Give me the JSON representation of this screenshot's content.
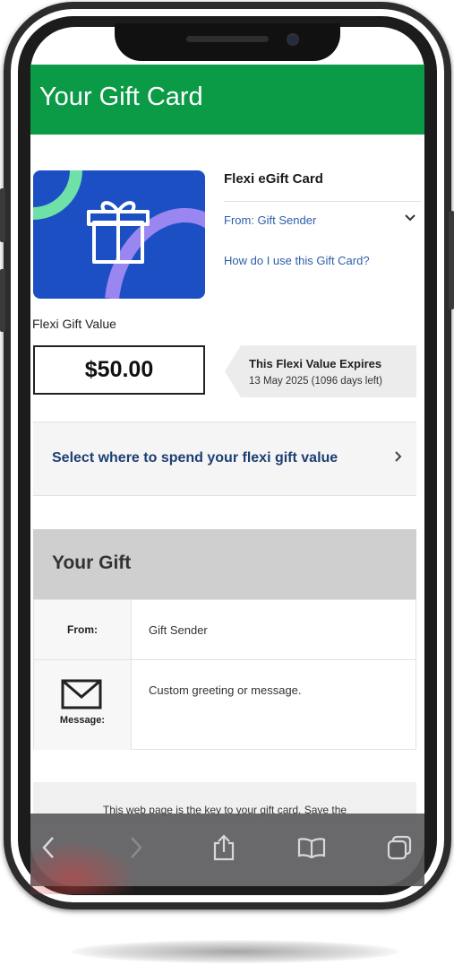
{
  "header": {
    "title": "Your Gift Card"
  },
  "card": {
    "title": "Flexi eGift Card",
    "from_selector": "From: Gift Sender",
    "help_link": "How do I use this Gift Card?",
    "image_icon": "gift-icon",
    "card_color": "#1d4fc4"
  },
  "value": {
    "label": "Flexi Gift Value",
    "amount": "$50.00"
  },
  "expiry": {
    "title": "This Flexi Value Expires",
    "date": "13 May 2025 (1096 days left)"
  },
  "spend": {
    "label": "Select where to spend your flexi gift value",
    "chevron_icon": "chevron-right-icon"
  },
  "gift": {
    "heading": "Your Gift",
    "from_label": "From:",
    "from_value": "Gift Sender",
    "message_label": "Message:",
    "message_value": "Custom greeting or message.",
    "message_icon": "envelope-icon"
  },
  "notice": {
    "text": "This web page is the key to your gift card. Save the"
  },
  "toolbar": {
    "icons": [
      "back-icon",
      "forward-icon",
      "share-icon",
      "bookmarks-icon",
      "tabs-icon"
    ]
  },
  "colors": {
    "brand_green": "#0b9a46",
    "link_blue": "#2d5ea8",
    "heading_navy": "#1d3f73"
  }
}
